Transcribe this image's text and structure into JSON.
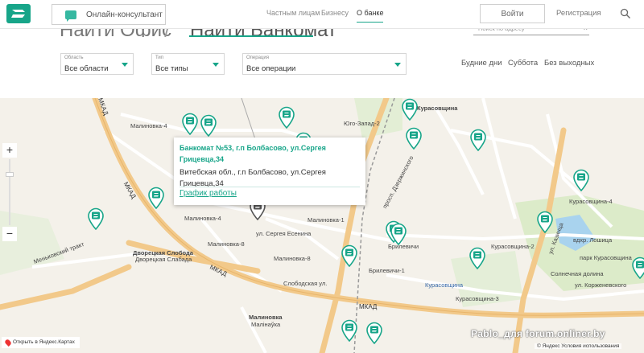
{
  "header": {
    "consult_label": "Онлайн-консультант",
    "nav": [
      "Частным лицам",
      "Бизнесу",
      "О банке"
    ],
    "login_label": "Войти",
    "register_label": "Регистрация"
  },
  "tabs": {
    "office": "Найти Офис",
    "separator": "/",
    "atm": "Найти Банкомат"
  },
  "search": {
    "placeholder": "Поиск по адресу",
    "clear": "×"
  },
  "filters": {
    "region": {
      "label": "Область",
      "value": "Все области"
    },
    "type": {
      "label": "Тип",
      "value": "Все типы"
    },
    "operation": {
      "label": "Операция",
      "value": "Все операции"
    }
  },
  "days": [
    "Будние дни",
    "Суббота",
    "Без выходных"
  ],
  "popup": {
    "title": "Банкомат №53, г.п Болбасово, ул.Сергея Грицевца,34",
    "address": "Витебская обл., г.п Болбасово, ул.Сергея Грицевца,34",
    "link": "График работы"
  },
  "map": {
    "labels": {
      "malinovka4": "Малиновка-4",
      "yugozapad2": "Юго-Запад-2",
      "malinovka1": "Малиновка-1",
      "malinovka8": "Малиновка-8",
      "dvorets1": "Дворецкая Слобода",
      "dvorets2": "Дворецкая Слабада",
      "malinovka_bottom": "Малиновка",
      "malinovka_bottom2": "Малінаўка",
      "brilevichi": "Брилевичи",
      "brilevichi1": "Брилевичи-1",
      "kurasovshchina": "Курасовщина",
      "kurasovshchina2": "Курасовщина-2",
      "kurasovshchina3": "Курасовщина-3",
      "kurasovshchina4": "Курасовщина-4",
      "solnechnaya": "Солнечная долина",
      "kurasovshchina_park": "парк Курасовщина",
      "lozhnitsa": "вдхр. Лошица",
      "mkad1": "МКАД",
      "mkad2": "МКАД",
      "mkad3": "МКАД",
      "mkad4": "МКАД",
      "slobodskaya": "Слободская ул.",
      "korzhenevskogo": "ул. Корженевского",
      "menkovsky": "Меньковский тракт",
      "sergeya_esenina": "ул. Сергея Есенина",
      "dzerzhinskogo": "просп. Дзержинского",
      "kazintsa": "ул. Казинца"
    },
    "open_yandex": "Открыть в Яндекс.Картах",
    "copyright": "© Яндекс Условия использования",
    "watermark": "Pablo_для forum.onliner.by",
    "zoom_plus": "+",
    "zoom_minus": "−"
  },
  "colors": {
    "accent": "#17a589",
    "road_major": "#f0c27a",
    "road_minor": "#ffffff",
    "park": "#cfe6b8",
    "water": "#a9d3ee"
  }
}
